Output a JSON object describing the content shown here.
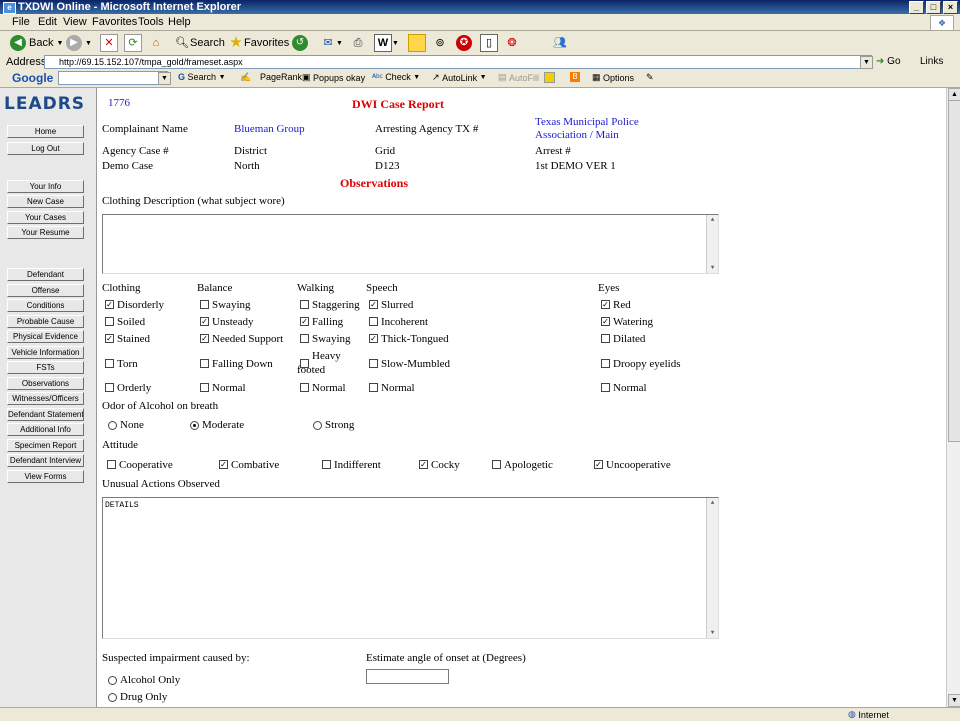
{
  "window": {
    "title": "TXDWI Online - Microsoft Internet Explorer"
  },
  "menu": [
    "File",
    "Edit",
    "View",
    "Favorites",
    "Tools",
    "Help"
  ],
  "toolbar": {
    "back": "Back",
    "search": "Search",
    "favorites": "Favorites"
  },
  "address": {
    "label": "Address",
    "url": "http://69.15.152.107/tmpa_gold/frameset.aspx",
    "go": "Go",
    "links": "Links"
  },
  "google": {
    "logo": "Google",
    "search": "Search",
    "pagerank": "PageRank",
    "popups": "Popups okay",
    "check": "Check",
    "autolink": "AutoLink",
    "autofill": "AutoFill",
    "options": "Options"
  },
  "sidebar": {
    "logo": "LEADRS",
    "buttons": [
      "Home",
      "Log Out",
      "Your Info",
      "New Case",
      "Your Cases",
      "Your Resume",
      "Defendant",
      "Offense",
      "Conditions",
      "Probable Cause",
      "Physical Evidence",
      "Vehicle Information",
      "FSTs",
      "Observations",
      "Witnesses/Officers",
      "Defendant Statement",
      "Additional Info",
      "Specimen Report",
      "Defendant Interview",
      "View Forms"
    ]
  },
  "report": {
    "case_no": "1776",
    "title": "DWI Case Report",
    "complainant_label": "Complainant Name",
    "complainant_value": "Blueman Group",
    "arresting_label": "Arresting Agency TX #",
    "arresting_value_1": "Texas Municipal Police",
    "arresting_value_2": "Association / Main",
    "agency_case_label": "Agency Case #",
    "district_label": "District",
    "grid_label": "Grid",
    "arrest_label": "Arrest #",
    "agency_case_value": "Demo Case",
    "district_value": "North",
    "grid_value": "D123",
    "arrest_value": "1st DEMO VER 1",
    "section_title": "Observations",
    "clothing_desc_label": "Clothing Description (what subject wore)",
    "clothing_desc_value": ""
  },
  "observations": {
    "headers": [
      "Clothing",
      "Balance",
      "Walking",
      "Speech",
      "Eyes"
    ],
    "clothing": [
      {
        "label": "Disorderly",
        "checked": true
      },
      {
        "label": "Soiled",
        "checked": false
      },
      {
        "label": "Stained",
        "checked": true
      },
      {
        "label": "Torn",
        "checked": false
      },
      {
        "label": "Orderly",
        "checked": false
      }
    ],
    "balance": [
      {
        "label": "Swaying",
        "checked": false
      },
      {
        "label": "Unsteady",
        "checked": true
      },
      {
        "label": "Needed Support",
        "checked": true
      },
      {
        "label": "Falling Down",
        "checked": false
      },
      {
        "label": "Normal",
        "checked": false
      }
    ],
    "walking": [
      {
        "label": "Staggering",
        "checked": false
      },
      {
        "label": "Falling",
        "checked": true
      },
      {
        "label": "Swaying",
        "checked": false
      },
      {
        "label": "Heavy",
        "label2": "footed",
        "checked": false
      },
      {
        "label": "Normal",
        "checked": false
      }
    ],
    "speech": [
      {
        "label": "Slurred",
        "checked": true
      },
      {
        "label": "Incoherent",
        "checked": false
      },
      {
        "label": "Thick-Tongued",
        "checked": true
      },
      {
        "label": "Slow-Mumbled",
        "checked": false
      },
      {
        "label": "Normal",
        "checked": false
      }
    ],
    "eyes": [
      {
        "label": "Red",
        "checked": true
      },
      {
        "label": "Watering",
        "checked": true
      },
      {
        "label": "Dilated",
        "checked": false
      },
      {
        "label": "Droopy eyelids",
        "checked": false
      },
      {
        "label": "Normal",
        "checked": false
      }
    ],
    "odor_label": "Odor of Alcohol on breath",
    "odor_options": [
      {
        "label": "None",
        "selected": false
      },
      {
        "label": "Moderate",
        "selected": true
      },
      {
        "label": "Strong",
        "selected": false
      }
    ],
    "attitude_label": "Attitude",
    "attitude": [
      {
        "label": "Cooperative",
        "checked": false
      },
      {
        "label": "Combative",
        "checked": true
      },
      {
        "label": "Indifferent",
        "checked": false
      },
      {
        "label": "Cocky",
        "checked": true
      },
      {
        "label": "Apologetic",
        "checked": false
      },
      {
        "label": "Uncooperative",
        "checked": true
      }
    ],
    "unusual_label": "Unusual Actions Observed",
    "unusual_value": "DETAILS",
    "impairment_label": "Suspected impairment caused by:",
    "impairment_options": [
      {
        "label": "Alcohol Only",
        "selected": false
      },
      {
        "label": "Drug Only",
        "selected": false
      }
    ],
    "angle_label": "Estimate angle of onset at (Degrees)",
    "angle_value": ""
  },
  "status": {
    "zone": "Internet"
  }
}
